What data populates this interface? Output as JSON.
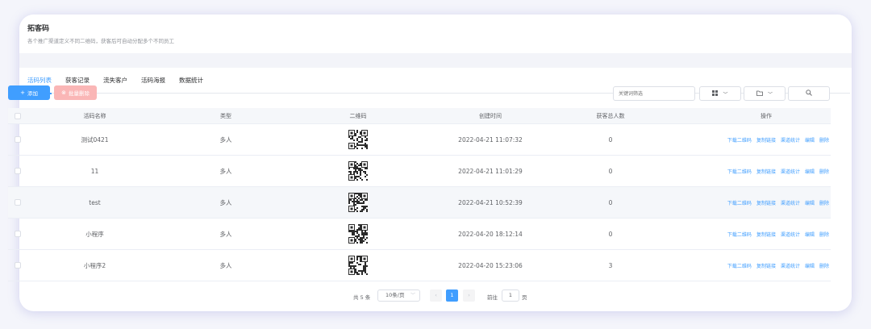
{
  "header": {
    "title": "拓客码",
    "subtitle": "各个推广渠道定义不同二维码，获客后可自动分配多个不同员工"
  },
  "tabs": [
    {
      "label": "活码列表",
      "active": true
    },
    {
      "label": "获客记录",
      "active": false
    },
    {
      "label": "流失客户",
      "active": false
    },
    {
      "label": "活码海报",
      "active": false
    },
    {
      "label": "数据统计",
      "active": false
    }
  ],
  "toolbar": {
    "add_label": "添加",
    "add_icon": "plus-icon",
    "batch_delete_label": "批量删除",
    "batch_delete_icon": "delete-icon",
    "search_placeholder": "关键词筛选",
    "tool1_icon": "grid-icon",
    "tool2_icon": "folder-icon",
    "tool3_icon": "search-icon",
    "caret": "﹀"
  },
  "table": {
    "columns": [
      "活码名称",
      "类型",
      "二维码",
      "创建时间",
      "获客总人数",
      "操作"
    ],
    "rows": [
      {
        "name": "测试0421",
        "type": "多人",
        "created": "2022-04-21 11:07:32",
        "count": "0"
      },
      {
        "name": "11",
        "type": "多人",
        "created": "2022-04-21 11:01:29",
        "count": "0"
      },
      {
        "name": "test",
        "type": "多人",
        "created": "2022-04-21 10:52:39",
        "count": "0"
      },
      {
        "name": "小程序",
        "type": "多人",
        "created": "2022-04-20 18:12:14",
        "count": "0"
      },
      {
        "name": "小程序2",
        "type": "多人",
        "created": "2022-04-20 15:23:06",
        "count": "3"
      }
    ],
    "actions": [
      "下载二维码",
      "复制链接",
      "渠道统计",
      "编辑",
      "删除"
    ]
  },
  "pagination": {
    "total": "共 5 条",
    "page_size": "10条/页",
    "prev": "‹",
    "current_page": "1",
    "next": "›",
    "goto_label": "前往",
    "goto_value": "1",
    "page_suffix": "页"
  },
  "colors": {
    "accent": "#409eff",
    "danger_disabled": "#fab6b6",
    "frame_shadow": "#7878d2"
  }
}
